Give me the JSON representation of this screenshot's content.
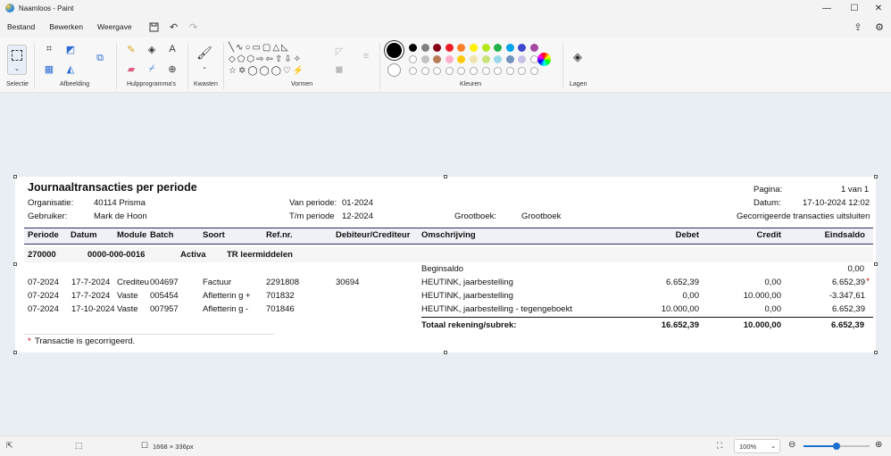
{
  "window": {
    "title": "Naamloos - Paint",
    "minimize": "—",
    "maximize": "☐",
    "close": "✕"
  },
  "menu": {
    "file": "Bestand",
    "edit": "Bewerken",
    "view": "Weergave"
  },
  "ribbon": {
    "groups": {
      "selection": "Selectie",
      "image": "Afbeelding",
      "tools": "Hulpprogramma's",
      "brushes": "Kwasten",
      "shapes": "Vormen",
      "colors": "Kleuren",
      "layers": "Lagen"
    },
    "palette_row1": [
      "#000000",
      "#7f7f7f",
      "#880015",
      "#ed1c24",
      "#ff7f27",
      "#fff200",
      "#b5e61d",
      "#22b14c",
      "#00a2e8",
      "#3f48cc",
      "#a349a4"
    ],
    "palette_row2": [
      "#ffffff",
      "#c3c3c3",
      "#b97a57",
      "#ffaec9",
      "#ffc90e",
      "#efe4b0",
      "#c8e47a",
      "#99d9ea",
      "#7092be",
      "#c8bfe7",
      "#ffffff"
    ]
  },
  "report": {
    "title": "Journaaltransacties per periode",
    "org_label": "Organisatie:",
    "org_value": "40114 Prisma",
    "user_label": "Gebruiker:",
    "user_value": "Mark de Hoon",
    "from_label": "Van periode:",
    "from_value": "01-2024",
    "to_label": "T/m periode",
    "to_value": "12-2024",
    "ledger_label": "Grootboek:",
    "ledger_value": "Grootboek",
    "page_label": "Pagina:",
    "page_value": "1 van 1",
    "date_label": "Datum:",
    "date_value": "17-10-2024 12:02",
    "exclude_note": "Gecorrigeerde transacties uitsluiten",
    "headers": {
      "periode": "Periode",
      "datum": "Datum",
      "module": "Module",
      "batch": "Batch",
      "soort": "Soort",
      "refnr": "Ref.nr.",
      "debcred": "Debiteur/Crediteur",
      "omschrijving": "Omschrijving",
      "debet": "Debet",
      "credit": "Credit",
      "eindsaldo": "Eindsaldo"
    },
    "account": {
      "code": "270000",
      "number": "0000-000-0016",
      "type": "Activa",
      "name": "TR leermiddelen"
    },
    "opening_label": "Beginsaldo",
    "opening_value": "0,00",
    "rows": [
      {
        "periode": "07-2024",
        "datum": "17-7-2024",
        "module": "Crediteu",
        "batch": "004697",
        "soort": "Factuur",
        "refnr": "2291808",
        "debcred": "30694",
        "omschrijving": "HEUTINK, jaarbestelling",
        "debet": "6.652,39",
        "credit": "0,00",
        "eindsaldo": "6.652,39",
        "mark": "*"
      },
      {
        "periode": "07-2024",
        "datum": "17-7-2024",
        "module": "Vaste",
        "batch": "005454",
        "soort": "Afletterin g +",
        "refnr": "701832",
        "debcred": "",
        "omschrijving": "HEUTINK, jaarbestelling",
        "debet": "0,00",
        "credit": "10.000,00",
        "eindsaldo": "-3.347,61",
        "mark": ""
      },
      {
        "periode": "07-2024",
        "datum": "17-10-2024",
        "module": "Vaste",
        "batch": "007957",
        "soort": "Afletterin g -",
        "refnr": "701846",
        "debcred": "",
        "omschrijving": "HEUTINK, jaarbestelling - tegengeboekt",
        "debet": "10.000,00",
        "credit": "0,00",
        "eindsaldo": "6.652,39",
        "mark": ""
      }
    ],
    "total_label": "Totaal rekening/subrek:",
    "total_debet": "16.652,39",
    "total_credit": "10.000,00",
    "total_saldo": "6.652,39",
    "footnote_mark": "*",
    "footnote": "Transactie is gecorrigeerd."
  },
  "status": {
    "canvas_size": "1668 × 336px",
    "zoom": "100%",
    "zoom_level": 0.5
  }
}
